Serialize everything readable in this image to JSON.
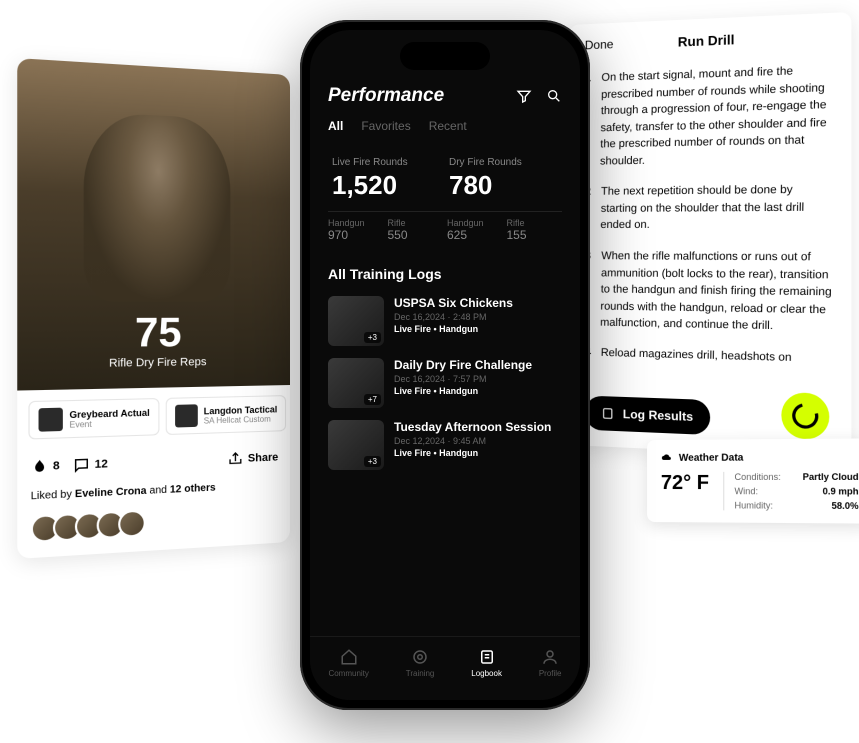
{
  "social": {
    "big_number": "75",
    "subtitle": "Rifle Dry Fire Reps",
    "tag1_title": "Greybeard Actual",
    "tag1_sub": "Event",
    "tag2_title": "Langdon Tactical",
    "tag2_sub": "SA Hellcat Custom",
    "likes": "8",
    "comments": "12",
    "share_label": "Share",
    "liked_prefix": "Liked by ",
    "liked_name": "Eveline Crona",
    "liked_mid": " and ",
    "liked_others": "12 others"
  },
  "phone": {
    "title": "Performance",
    "tabs": {
      "all": "All",
      "fav": "Favorites",
      "recent": "Recent"
    },
    "live_label": "Live Fire Rounds",
    "live_val": "1,520",
    "dry_label": "Dry Fire Rounds",
    "dry_val": "780",
    "sub1_label": "Handgun",
    "sub1_val": "970",
    "sub2_label": "Rifle",
    "sub2_val": "550",
    "sub3_label": "Handgun",
    "sub3_val": "625",
    "sub4_label": "Rifle",
    "sub4_val": "155",
    "section": "All Training Logs",
    "log1_title": "USPSA Six Chickens",
    "log1_date": "Dec 16,2024 · 2:48 PM",
    "log1_meta": "Live Fire • Handgun",
    "log1_badge": "+3",
    "log2_title": "Daily Dry Fire Challenge",
    "log2_date": "Dec 16,2024 · 7:57 PM",
    "log2_meta": "Live Fire • Handgun",
    "log2_badge": "+7",
    "log3_title": "Tuesday Afternoon Session",
    "log3_date": "Dec 12,2024 · 9:45 AM",
    "log3_meta": "Live Fire • Handgun",
    "log3_badge": "+3",
    "nav": {
      "community": "Community",
      "training": "Training",
      "logbook": "Logbook",
      "profile": "Profile"
    }
  },
  "drill": {
    "done": "Done",
    "title": "Run Drill",
    "step1_num": "1",
    "step1_text": "On the start signal, mount and fire the prescribed number of rounds while shooting through a progression of four, re-engage the safety, transfer to the other shoulder and fire the prescribed number of rounds on that shoulder.",
    "step2_num": "2",
    "step2_text": "The next repetition should be done by starting on the shoulder that the last drill ended on.",
    "step3_num": "3",
    "step3_text": "When the rifle malfunctions or runs out of ammunition (bolt locks to the rear), transition to the handgun and finish firing the remaining rounds with the handgun, reload or clear the malfunction, and continue the drill.",
    "step4_num": "4",
    "step4_text": "Reload magazines drill, headshots on",
    "log_results": "Log Results"
  },
  "weather": {
    "title": "Weather Data",
    "temp": "72° F",
    "cond_label": "Conditions:",
    "cond_val": "Partly Cloud",
    "wind_label": "Wind:",
    "wind_val": "0.9 mph",
    "hum_label": "Humidity:",
    "hum_val": "58.0%"
  }
}
